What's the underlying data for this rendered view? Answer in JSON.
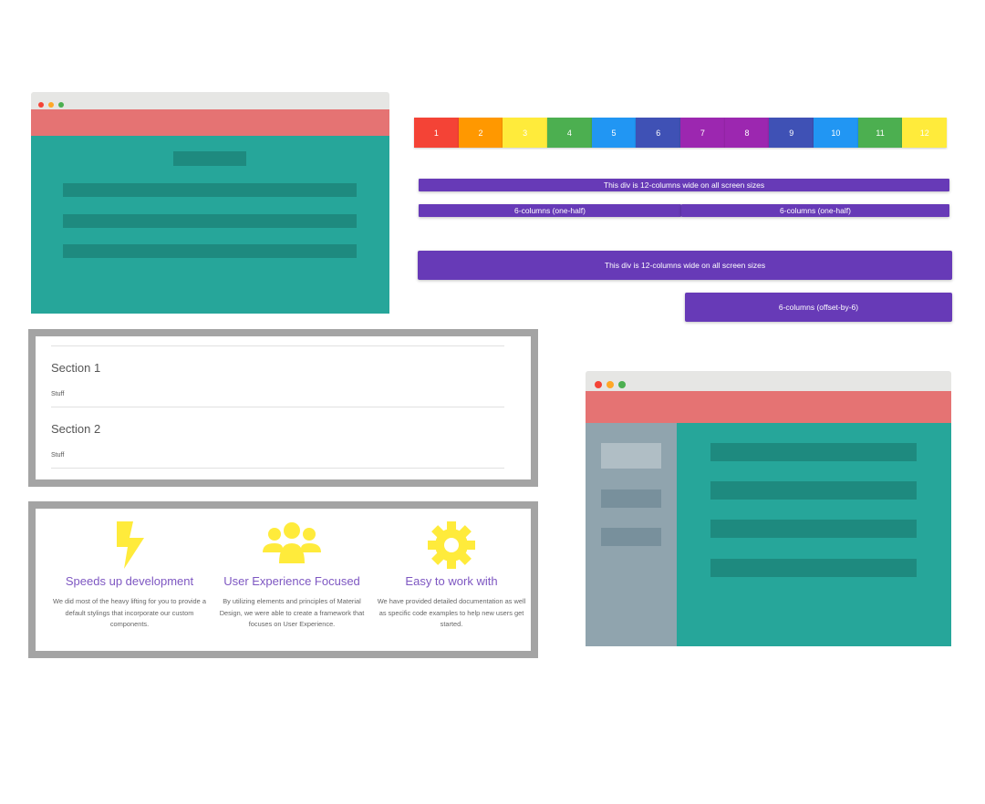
{
  "colors": {
    "chrome": "#e6e6e4",
    "navbar": "#e57373",
    "teal": "#26a69a",
    "teal_dark": "#1e8a7f",
    "sidenav": "#90a4ae",
    "purple": "#673ab7",
    "accent_text": "#7e57c2",
    "frame": "#a4a4a4",
    "icon_yellow": "#ffeb3b",
    "dot_red": "#f44336",
    "dot_yellow": "#ffa726",
    "dot_green": "#4caf50"
  },
  "grid_columns": [
    {
      "label": "1",
      "color": "#f44336"
    },
    {
      "label": "2",
      "color": "#ff9800"
    },
    {
      "label": "3",
      "color": "#ffeb3b"
    },
    {
      "label": "4",
      "color": "#4caf50"
    },
    {
      "label": "5",
      "color": "#2196f3"
    },
    {
      "label": "6",
      "color": "#3f51b5"
    },
    {
      "label": "7",
      "color": "#9c27b0"
    },
    {
      "label": "8",
      "color": "#9c27b0"
    },
    {
      "label": "9",
      "color": "#3f51b5"
    },
    {
      "label": "10",
      "color": "#2196f3"
    },
    {
      "label": "11",
      "color": "#4caf50"
    },
    {
      "label": "12",
      "color": "#ffeb3b"
    }
  ],
  "grid_demo": {
    "small_full": "This div is 12-columns wide on all screen sizes",
    "half_left": "6-columns (one-half)",
    "half_right": "6-columns (one-half)",
    "large_full": "This div is 12-columns wide on all screen sizes",
    "offset": "6-columns (offset-by-6)"
  },
  "collapsible": {
    "sections": [
      {
        "title": "Section 1",
        "body": "Stuff"
      },
      {
        "title": "Section 2",
        "body": "Stuff"
      }
    ]
  },
  "features": [
    {
      "icon": "flash-icon",
      "title": "Speeds up development",
      "description": "We did most of the heavy lifting for you to provide a default stylings that incorporate our custom components."
    },
    {
      "icon": "group-icon",
      "title": "User Experience Focused",
      "description": "By utilizing elements and principles of Material Design, we were able to create a framework that focuses on User Experience."
    },
    {
      "icon": "settings-icon",
      "title": "Easy to work with",
      "description": "We have provided detailed documentation as well as specific code examples to help new users get started."
    }
  ]
}
